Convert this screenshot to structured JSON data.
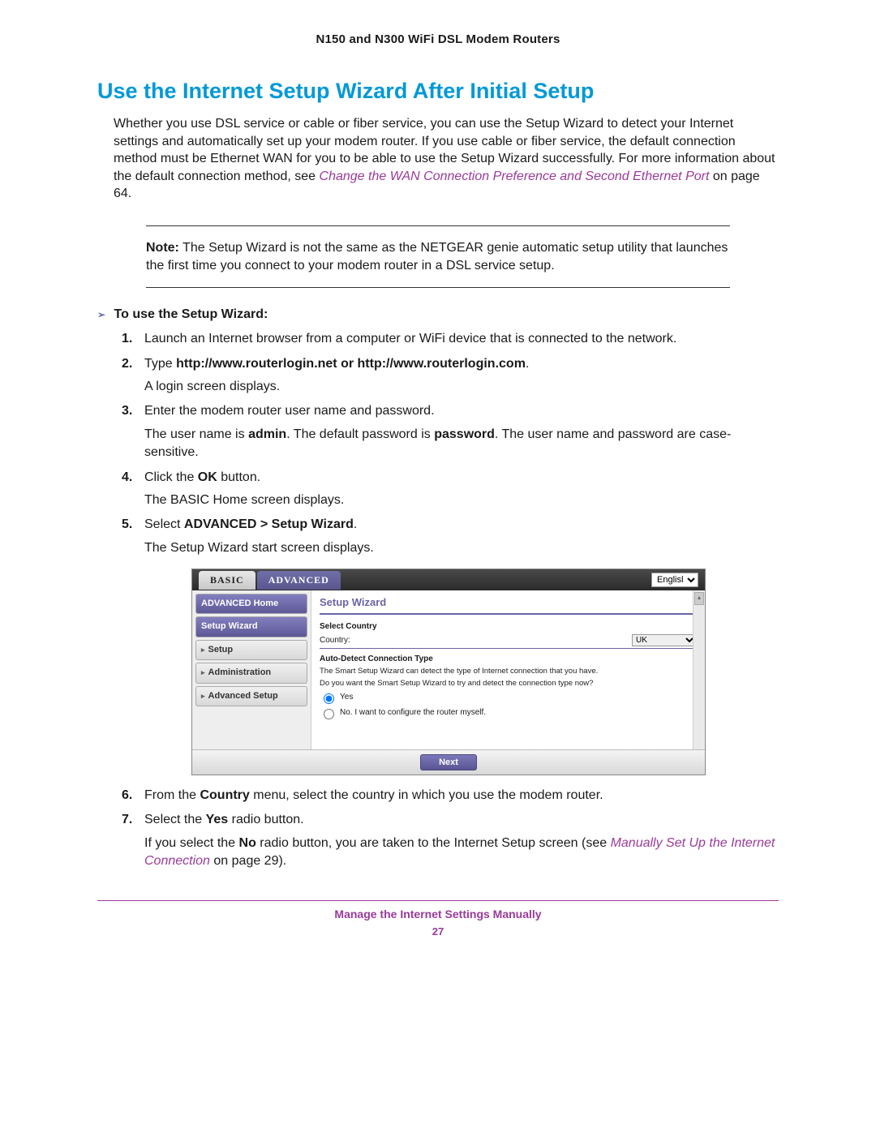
{
  "header": {
    "product_line": "N150 and N300 WiFi DSL Modem Routers"
  },
  "section": {
    "title": "Use the Internet Setup Wizard After Initial Setup"
  },
  "intro": {
    "body": "Whether you use DSL service or cable or fiber service, you can use the Setup Wizard to detect your Internet settings and automatically set up your modem router. If you use cable or fiber service, the default connection method must be Ethernet WAN for you to be able to use the Setup Wizard successfully. For more information about the default connection method, see ",
    "xref": "Change the WAN Connection Preference and Second Ethernet Port",
    "after": " on page 64."
  },
  "note": {
    "label": "Note:",
    "body": "The Setup Wizard is not the same as the NETGEAR genie automatic setup utility that launches the first time you connect to your modem router in a DSL service setup."
  },
  "task": {
    "triangle": "➢",
    "title": "To use the Setup Wizard:"
  },
  "steps": {
    "s1": {
      "num": "1.",
      "text": "Launch an Internet browser from a computer or WiFi device that is connected to the network."
    },
    "s2": {
      "num": "2.",
      "lead": "Type ",
      "bold": "http://www.routerlogin.net or http://www.routerlogin.com",
      "trail": ".",
      "sub": "A login screen displays."
    },
    "s3": {
      "num": "3.",
      "text": "Enter the modem router user name and password.",
      "sub_a": "The user name is ",
      "sub_admin": "admin",
      "sub_b": ". The default password is ",
      "sub_pw": "password",
      "sub_c": ". The user name and password are case-sensitive."
    },
    "s4": {
      "num": "4.",
      "lead": "Click the ",
      "bold": "OK",
      "trail": " button.",
      "sub": "The BASIC Home screen displays."
    },
    "s5": {
      "num": "5.",
      "lead": "Select ",
      "bold": "ADVANCED > Setup Wizard",
      "trail": ".",
      "sub": "The Setup Wizard start screen displays."
    },
    "s6": {
      "num": "6.",
      "lead": "From the ",
      "bold": "Country",
      "trail": " menu, select the country in which you use the modem router."
    },
    "s7": {
      "num": "7.",
      "lead": "Select the ",
      "bold": "Yes",
      "trail": " radio button.",
      "sub_a": "If you select the ",
      "sub_no": "No",
      "sub_b": " radio button, you are taken to the Internet Setup screen (see ",
      "xref": "Manually Set Up the Internet Connection",
      "sub_c": " on page 29)."
    }
  },
  "screenshot": {
    "tabs": {
      "basic": "BASIC",
      "advanced": "ADVANCED"
    },
    "language": "English",
    "sidebar": {
      "home": "ADVANCED Home",
      "wizard": "Setup Wizard",
      "setup": "Setup",
      "admin": "Administration",
      "advsetup": "Advanced Setup"
    },
    "main": {
      "title": "Setup Wizard",
      "select_country_label": "Select Country",
      "country_label": "Country:",
      "country_value": "UK",
      "autodetect_label": "Auto-Detect Connection Type",
      "desc1": "The Smart Setup Wizard can detect the type of Internet connection that you have.",
      "desc2": "Do you want the Smart Setup Wizard to try and detect the connection type now?",
      "opt_yes": "Yes",
      "opt_no": "No. I want to configure the router myself.",
      "next_btn": "Next"
    }
  },
  "footer": {
    "chapter": "Manage the Internet Settings Manually",
    "page": "27"
  }
}
